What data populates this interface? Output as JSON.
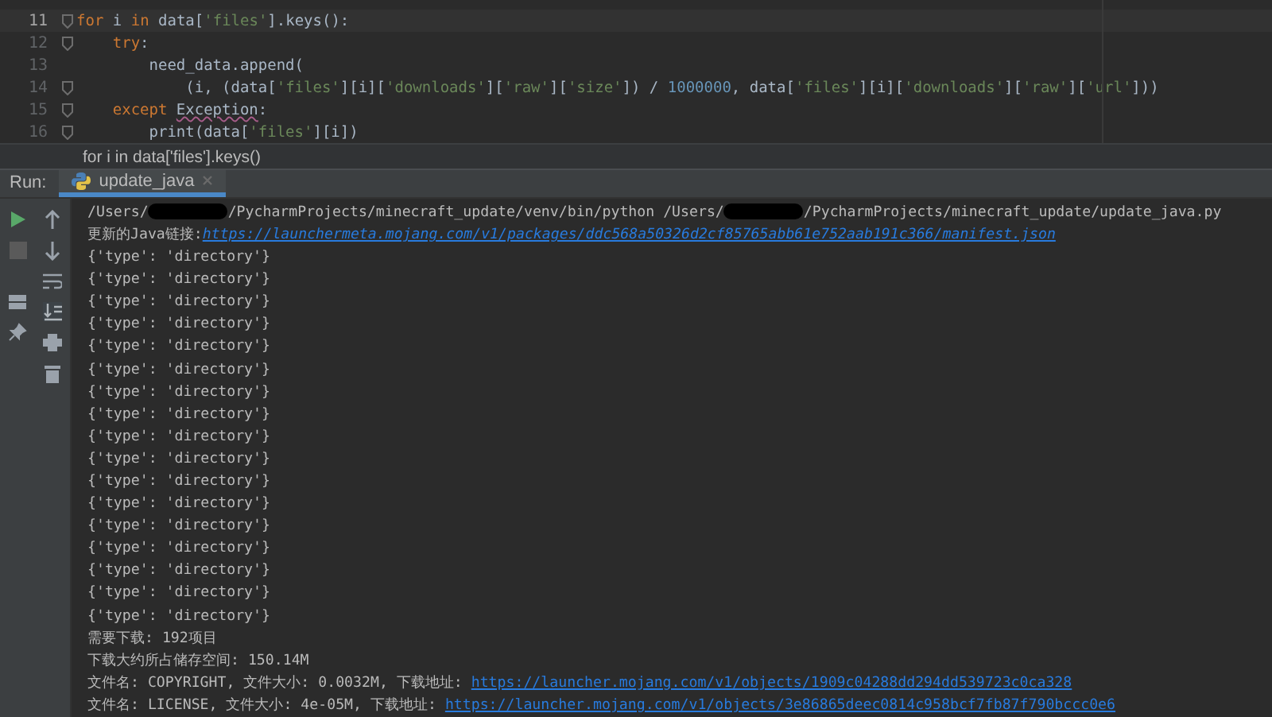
{
  "editor": {
    "lines": [
      {
        "number": "11",
        "current": true,
        "tokens": [
          {
            "kind": "keyword",
            "text": "for"
          },
          {
            "kind": "plain",
            "text": " i "
          },
          {
            "kind": "keyword",
            "text": "in"
          },
          {
            "kind": "plain",
            "text": " data["
          },
          {
            "kind": "string",
            "text": "'files'"
          },
          {
            "kind": "plain",
            "text": "].keys():"
          }
        ]
      },
      {
        "number": "12",
        "current": false,
        "tokens": [
          {
            "kind": "keyword",
            "text": "    try"
          },
          {
            "kind": "plain",
            "text": ":"
          }
        ]
      },
      {
        "number": "13",
        "current": false,
        "tokens": [
          {
            "kind": "plain",
            "text": "        need_data.append("
          }
        ]
      },
      {
        "number": "14",
        "current": false,
        "tokens": [
          {
            "kind": "plain",
            "text": "            (i, (data["
          },
          {
            "kind": "string",
            "text": "'files'"
          },
          {
            "kind": "plain",
            "text": "][i]["
          },
          {
            "kind": "string",
            "text": "'downloads'"
          },
          {
            "kind": "plain",
            "text": "]["
          },
          {
            "kind": "string",
            "text": "'raw'"
          },
          {
            "kind": "plain",
            "text": "]["
          },
          {
            "kind": "string",
            "text": "'size'"
          },
          {
            "kind": "plain",
            "text": "]) / "
          },
          {
            "kind": "number",
            "text": "1000000"
          },
          {
            "kind": "plain",
            "text": ", data["
          },
          {
            "kind": "string",
            "text": "'files'"
          },
          {
            "kind": "plain",
            "text": "][i]["
          },
          {
            "kind": "string",
            "text": "'downloads'"
          },
          {
            "kind": "plain",
            "text": "]["
          },
          {
            "kind": "string",
            "text": "'raw'"
          },
          {
            "kind": "plain",
            "text": "]["
          },
          {
            "kind": "string",
            "text": "'url'"
          },
          {
            "kind": "plain",
            "text": "]))"
          }
        ]
      },
      {
        "number": "15",
        "current": false,
        "tokens": [
          {
            "kind": "keyword",
            "text": "    except "
          },
          {
            "kind": "warning",
            "text": "Exception"
          },
          {
            "kind": "plain",
            "text": ":"
          }
        ]
      },
      {
        "number": "16",
        "current": false,
        "tokens": [
          {
            "kind": "plain",
            "text": "        print(data["
          },
          {
            "kind": "string",
            "text": "'files'"
          },
          {
            "kind": "plain",
            "text": "][i])"
          }
        ]
      }
    ],
    "breadcrumb": "for i in data['files'].keys()"
  },
  "run_panel": {
    "label": "Run:",
    "tabs": [
      {
        "label": "update_java",
        "selected": true
      }
    ]
  },
  "console": {
    "lines": [
      {
        "parts": [
          {
            "kind": "text",
            "text": "/Users/"
          },
          {
            "kind": "redacted"
          },
          {
            "kind": "text",
            "text": "/PycharmProjects/minecraft_update/venv/bin/python /Users/"
          },
          {
            "kind": "redacted"
          },
          {
            "kind": "text",
            "text": "/PycharmProjects/minecraft_update/update_java.py"
          }
        ]
      },
      {
        "parts": [
          {
            "kind": "text",
            "text": "更新的Java链接:"
          },
          {
            "kind": "link",
            "text": "https://launchermeta.mojang.com/v1/packages/ddc568a50326d2cf85765abb61e752aab191c366/manifest.json"
          }
        ]
      },
      {
        "parts": [
          {
            "kind": "text",
            "text": "{'type': 'directory'}"
          }
        ]
      },
      {
        "parts": [
          {
            "kind": "text",
            "text": "{'type': 'directory'}"
          }
        ]
      },
      {
        "parts": [
          {
            "kind": "text",
            "text": "{'type': 'directory'}"
          }
        ]
      },
      {
        "parts": [
          {
            "kind": "text",
            "text": "{'type': 'directory'}"
          }
        ]
      },
      {
        "parts": [
          {
            "kind": "text",
            "text": "{'type': 'directory'}"
          }
        ]
      },
      {
        "parts": [
          {
            "kind": "text",
            "text": "{'type': 'directory'}"
          }
        ]
      },
      {
        "parts": [
          {
            "kind": "text",
            "text": "{'type': 'directory'}"
          }
        ]
      },
      {
        "parts": [
          {
            "kind": "text",
            "text": "{'type': 'directory'}"
          }
        ]
      },
      {
        "parts": [
          {
            "kind": "text",
            "text": "{'type': 'directory'}"
          }
        ]
      },
      {
        "parts": [
          {
            "kind": "text",
            "text": "{'type': 'directory'}"
          }
        ]
      },
      {
        "parts": [
          {
            "kind": "text",
            "text": "{'type': 'directory'}"
          }
        ]
      },
      {
        "parts": [
          {
            "kind": "text",
            "text": "{'type': 'directory'}"
          }
        ]
      },
      {
        "parts": [
          {
            "kind": "text",
            "text": "{'type': 'directory'}"
          }
        ]
      },
      {
        "parts": [
          {
            "kind": "text",
            "text": "{'type': 'directory'}"
          }
        ]
      },
      {
        "parts": [
          {
            "kind": "text",
            "text": "{'type': 'directory'}"
          }
        ]
      },
      {
        "parts": [
          {
            "kind": "text",
            "text": "{'type': 'directory'}"
          }
        ]
      },
      {
        "parts": [
          {
            "kind": "text",
            "text": "{'type': 'directory'}"
          }
        ]
      },
      {
        "parts": [
          {
            "kind": "text",
            "text": "需要下载: 192项目"
          }
        ]
      },
      {
        "parts": [
          {
            "kind": "text",
            "text": "下载大约所占储存空间: 150.14M"
          }
        ]
      },
      {
        "parts": [
          {
            "kind": "text",
            "text": "文件名: COPYRIGHT, 文件大小: 0.0032M, 下载地址: "
          },
          {
            "kind": "link",
            "text": "https://launcher.mojang.com/v1/objects/1909c04288dd294dd539723c0ca328"
          }
        ]
      },
      {
        "parts": [
          {
            "kind": "text",
            "text": "文件名: LICENSE, 文件大小: 4e-05M, 下载地址: "
          },
          {
            "kind": "link",
            "text": "https://launcher.mojang.com/v1/objects/3e86865deec0814c958bcf7fb87f790bccc0e6"
          }
        ]
      }
    ]
  }
}
